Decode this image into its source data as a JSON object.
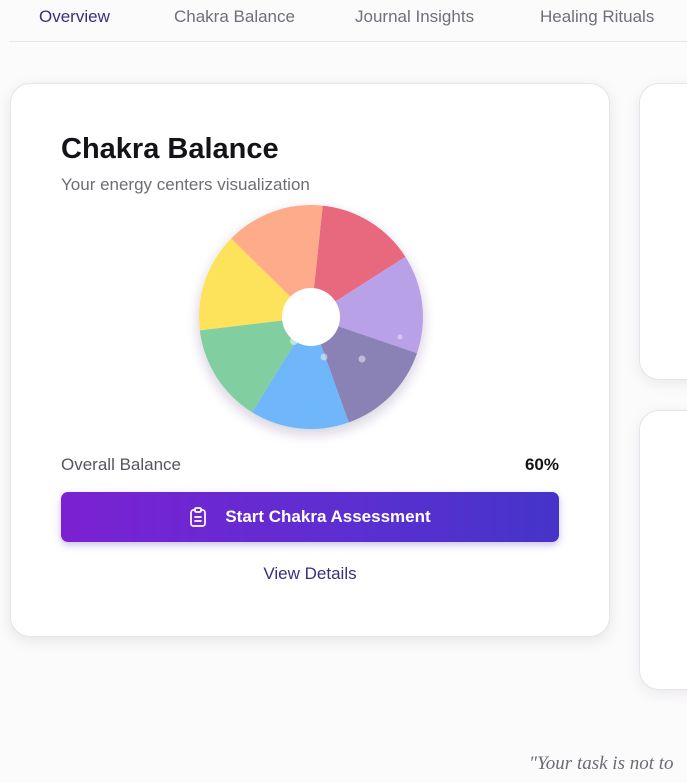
{
  "nav": {
    "tabs": [
      {
        "label": "Overview",
        "active": true
      },
      {
        "label": "Chakra Balance",
        "active": false
      },
      {
        "label": "Journal Insights",
        "active": false
      },
      {
        "label": "Healing Rituals",
        "active": false
      }
    ]
  },
  "card": {
    "title": "Chakra Balance",
    "subtitle": "Your energy centers visualization",
    "balance_label": "Overall Balance",
    "balance_value": "60%",
    "cta_label": "Start Chakra Assessment",
    "cta_icon": "clipboard-icon",
    "link_label": "View Details"
  },
  "chakra_wheel": {
    "segments": [
      {
        "color": "#e8677e",
        "share": 1
      },
      {
        "color": "#b8a1e6",
        "share": 1
      },
      {
        "color": "#8a81b4",
        "share": 1
      },
      {
        "color": "#6fb6fb",
        "share": 1
      },
      {
        "color": "#81cfa1",
        "share": 1
      },
      {
        "color": "#fde25c",
        "share": 1
      },
      {
        "color": "#fdab8b",
        "share": 1
      }
    ]
  },
  "colors": {
    "accent": "#3b2f7d",
    "button_start": "#7b21d2",
    "button_end": "#4534c9"
  },
  "footer": {
    "quote": "\"Your task is not to"
  }
}
